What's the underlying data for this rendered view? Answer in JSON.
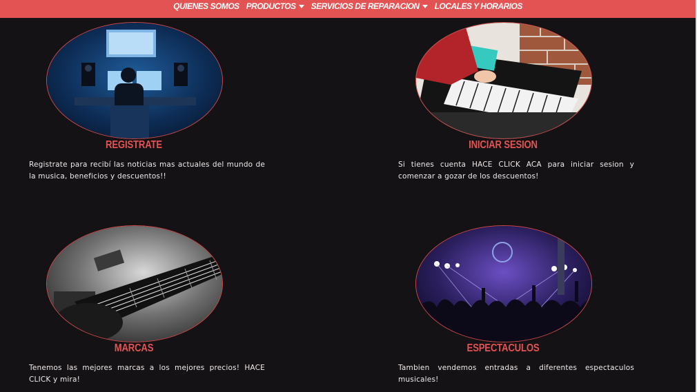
{
  "nav": {
    "items": [
      {
        "label": "QUIENES SOMOS",
        "dropdown": false
      },
      {
        "label": "PRODUCTOS",
        "dropdown": true
      },
      {
        "label": "SERVICIOS DE REPARACION",
        "dropdown": true
      },
      {
        "label": "LOCALES Y HORARIOS",
        "dropdown": false
      }
    ]
  },
  "cards": [
    {
      "title": "REGISTRATE",
      "description": "Registrate para recibí las noticias mas actuales del mundo de la musica, beneficios y descuentos!!",
      "image": "music-studio-photo"
    },
    {
      "title": "INICIAR SESION",
      "description": "Si tienes cuenta HACE CLICK ACA para iniciar sesion y comenzar a gozar de los descuentos!",
      "image": "midi-keyboard-photo"
    },
    {
      "title": "MARCAS",
      "description": "Tenemos las mejores marcas a los mejores precios! HACE CLICK y mira!",
      "image": "guitar-photo"
    },
    {
      "title": "ESPECTACULOS",
      "description": "Tambien vendemos entradas a diferentes espectaculos musicales!",
      "image": "concert-crowd-photo"
    }
  ],
  "colors": {
    "accent": "#e35353",
    "background": "#141214",
    "text": "#f1eaea"
  }
}
